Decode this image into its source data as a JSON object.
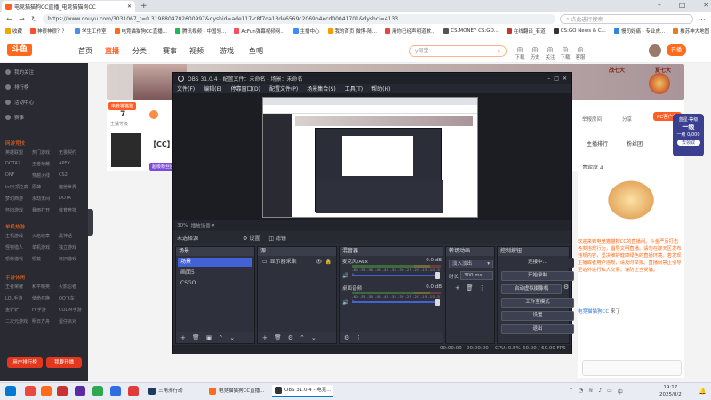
{
  "browser": {
    "tab_title": "电竞猫猫狗CC直播_电竞猫猫狗CC",
    "url": "https://www.douyu.com/3031067_r=0.3198804702600997&dyshid=ade117-c8f7da13d46569c2069b4ecd00041701&dyshci=4133",
    "search_placeholder": "点此进行搜索",
    "bookmarks": [
      "收藏",
      "神很神很？？",
      "学生工作室",
      "电竞猫猫狗CC直播...",
      "腾讯视频 - 中国领...",
      "AcFun弹幕视频网...",
      "主播中心",
      "我的首页 微博-随...",
      "用你已经声明道歉...",
      "CS.MONEY CS:GO...",
      "在线翻译_有道",
      "CS:GO News & C...",
      "慢司好痛 - 专业虎...",
      "推苏神大地图 - 网...",
      "其他收藏夹"
    ]
  },
  "site": {
    "logo_text": "斗鱼",
    "nav": [
      "首页",
      "直播",
      "分类",
      "赛事",
      "视频",
      "游戏",
      "鱼吧"
    ],
    "search_placeholder": "y阿宝",
    "header_icons": [
      "下载",
      "历史",
      "关注",
      "下载",
      "客服"
    ],
    "open_button": "开播"
  },
  "sidebar": {
    "items": [
      "我的关注",
      "排行榜",
      "活动中心",
      "赛事"
    ],
    "sections": [
      {
        "title": "网游竞技",
        "games": [
          "英雄联盟",
          "热门游戏",
          "无畏契约",
          "DOTA2",
          "王者荣耀",
          "APEX",
          "DNF",
          "穿越火线",
          "CS2",
          "lol云顶之弈",
          "原神",
          "魔兽世界",
          "梦幻西游",
          "永劫无间",
          "DOTA",
          "怀旧游戏",
          "暴雨打开",
          "体育竞技"
        ]
      },
      {
        "title": "单机热游",
        "games": [
          "主机游戏",
          "火焰纹章",
          "黑神话",
          "怪物猎人",
          "单机游戏",
          "独立游戏",
          "恐怖游戏",
          "饥荒",
          "怀旧游戏"
        ]
      },
      {
        "title": "手游休闲",
        "games": [
          "王者荣耀",
          "和平精英",
          "火影忍者",
          "LOL手游",
          "使命召唤",
          "QQ飞车",
          "金铲铲",
          "FF手游",
          "CODM手游",
          "二次元游戏",
          "明日方舟",
          "蛋仔派对"
        ]
      }
    ],
    "btn_left": "用户排行榜",
    "btn_right": "我要开播"
  },
  "banner": {
    "left_tag": "战七大",
    "right_tag": "夏七大"
  },
  "stream": {
    "room_tag": "电竞猫猫狗",
    "fans": "7",
    "fans_label": "主播等级",
    "room_name": "【CC】F",
    "fan_badge": "超级粉丝团",
    "report": "举报房间",
    "share": "分享",
    "pc_client": "PC客户端",
    "level_name": "蓝星·等级",
    "level_badge": "一级",
    "level_value": "一级 0/000",
    "claim": "去领取",
    "rank_tabs": [
      "主播排行",
      "粉丝团"
    ],
    "chat_title": "贵宾席 4"
  },
  "chat": {
    "text": "欢迎来到电竞猫猫狗CC的直播间。斗鱼严厉打击各类违规行为，倡导文明直播。请勿在聊天区发布违规内容，坚决维护健康绿色的直播环境。若发现主播或者用户违规，请及时举报。直播间禁止引导至站外进行私人交易，谨防上当受骗。",
    "user_line": "电竞猫猫狗CC",
    "user_action": "来了"
  },
  "obs": {
    "title": "OBS 31.0.4 - 配置文件：未命名 - 场景：未命名",
    "menu": [
      "文件(F)",
      "编辑(E)",
      "停靠窗口(D)",
      "配置文件(P)",
      "场景集合(S)",
      "工具(T)",
      "帮助(H)"
    ],
    "zoom": "30%",
    "ctx_label": "播放场景",
    "no_source": "未选择源",
    "properties": "设置",
    "filters": "滤镜",
    "docks": {
      "scenes": {
        "title": "场景",
        "items": [
          "场景",
          "画面5",
          "CSGO"
        ],
        "selected": 0
      },
      "sources": {
        "title": "源",
        "items": [
          "显示器采集"
        ]
      },
      "mixer": {
        "title": "混音器",
        "channels": [
          {
            "name": "麦克风/Aux",
            "db": "0.0 dB"
          },
          {
            "name": "桌面音频",
            "db": "0.0 dB"
          }
        ],
        "ticks": "-60 -55 -50 -45 -40 -35 -30 -25 -20 -15 -10 -5 0"
      },
      "transitions": {
        "title": "转场动画",
        "value": "淡入淡出",
        "duration_label": "时长",
        "duration": "300 ms"
      },
      "controls": {
        "title": "控制按钮",
        "buttons": [
          "连接中...",
          "开始录制",
          "启动虚拟摄像机",
          "工作室模式",
          "设置",
          "退出"
        ]
      }
    },
    "status": {
      "stream_time": "00:00:00",
      "rec_time": "00:00:00",
      "cpu": "CPU: 0.5%",
      "fps": "60.00 / 60.00 FPS"
    }
  },
  "taskbar": {
    "apps": [
      "三角洲行动",
      "电竞猫猫狗CC直播...",
      "OBS 31.0.4 - 电竞..."
    ],
    "time": "19:17",
    "date": "2025/8/2"
  }
}
